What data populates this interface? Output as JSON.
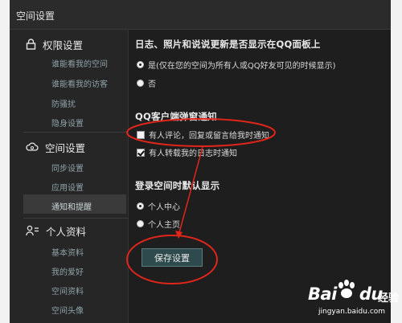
{
  "window": {
    "title": "空间设置"
  },
  "sidebar": {
    "sections": [
      {
        "icon": "lock-icon",
        "label": "权限设置",
        "items": [
          "谁能看我的空间",
          "谁能看我的访客",
          "防骚扰",
          "隐身设置"
        ]
      },
      {
        "icon": "cloud-gear-icon",
        "label": "空间设置",
        "items": [
          "同步设置",
          "应用设置",
          "通知和提醒"
        ]
      },
      {
        "icon": "user-card-icon",
        "label": "个人资料",
        "items": [
          "基本资料",
          "我的爱好",
          "空间资料",
          "空间头像"
        ]
      }
    ],
    "active_item": "通知和提醒"
  },
  "main": {
    "section1": {
      "heading": "日志、照片和说说更新是否显示在QQ面板上",
      "options": [
        {
          "label": "是(仅在您的空间为所有人或QQ好友可见的时候显示)",
          "selected": true
        },
        {
          "label": "否",
          "selected": false
        }
      ]
    },
    "section2": {
      "heading": "QQ客户端弹窗通知",
      "options": [
        {
          "label": "有人评论，回复或留言给我时通知",
          "checked": false
        },
        {
          "label": "有人转载我的日志时通知",
          "checked": true
        }
      ]
    },
    "section3": {
      "heading": "登录空间时默认显示",
      "options": [
        {
          "label": "个人中心",
          "selected": true
        },
        {
          "label": "个人主页",
          "selected": false
        }
      ]
    },
    "save_label": "保存设置"
  },
  "watermark": {
    "brand": "Bai",
    "brand2": "du",
    "cn": "经验",
    "url": "jingyan.baidu.com"
  },
  "colors": {
    "annotation": "#e0251b",
    "accent": "#2f4a4c"
  }
}
